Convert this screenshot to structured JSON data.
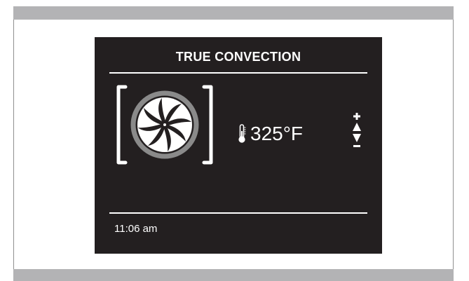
{
  "display": {
    "mode_title": "TRUE CONVECTION",
    "temperature": "325°F",
    "time": "11:06 am",
    "icons": {
      "fan": "fan-icon",
      "thermometer": "thermometer-icon",
      "increase": "plus-icon",
      "decrease": "minus-icon",
      "up": "triangle-up-icon",
      "down": "triangle-down-icon"
    }
  },
  "colors": {
    "screen_bg": "#231f20",
    "frame_bar": "#b3b3b5",
    "text": "#ffffff",
    "fan_ring": "#8a8a8a"
  }
}
